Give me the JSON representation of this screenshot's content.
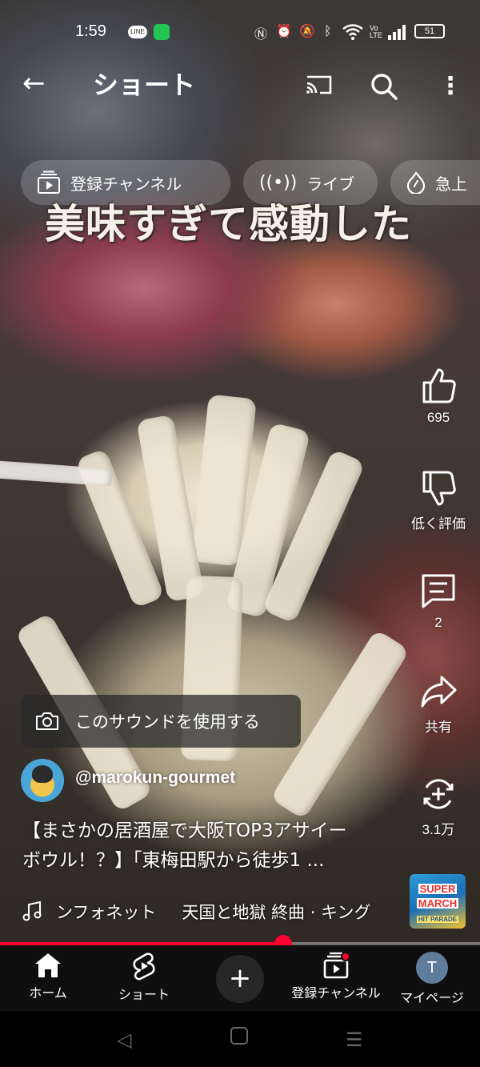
{
  "status_bar": {
    "time": "1:59",
    "line_badge": "LINE",
    "battery": "51"
  },
  "top_bar": {
    "title": "ショート"
  },
  "chips": [
    {
      "label": "登録チャンネル",
      "icon": "subscriptions-icon"
    },
    {
      "label": "ライブ",
      "icon": "live-icon"
    },
    {
      "label": "急上",
      "icon": "trending-icon"
    }
  ],
  "video": {
    "overlay_caption": "美味すぎて感動した"
  },
  "actions": {
    "like_count": "695",
    "dislike_label": "低く評価",
    "comment_count": "2",
    "share_label": "共有",
    "remix_count": "3.1万"
  },
  "sound_button": {
    "label": "このサウンドを使用する"
  },
  "channel": {
    "handle": "@marokun-gourmet"
  },
  "description": {
    "line1": "【まさかの居酒屋で大阪TOP3アサイー",
    "line2": "ボウル！？】「東梅田駅から徒歩1 ..."
  },
  "music": {
    "artist_part": "ンフォネット",
    "title_part": "天国と地獄 終曲 · キング"
  },
  "album_art": {
    "line1": "SUPER",
    "line2": "MARCH",
    "line3": "HIT PARADE"
  },
  "progress": {
    "fraction": 0.59
  },
  "bottom_nav": {
    "home": "ホーム",
    "shorts": "ショート",
    "subscriptions": "登録チャンネル",
    "you": "マイページ",
    "you_initial": "T"
  },
  "colors": {
    "accent": "#ff0033",
    "nav_bg": "#0f0f0f"
  }
}
